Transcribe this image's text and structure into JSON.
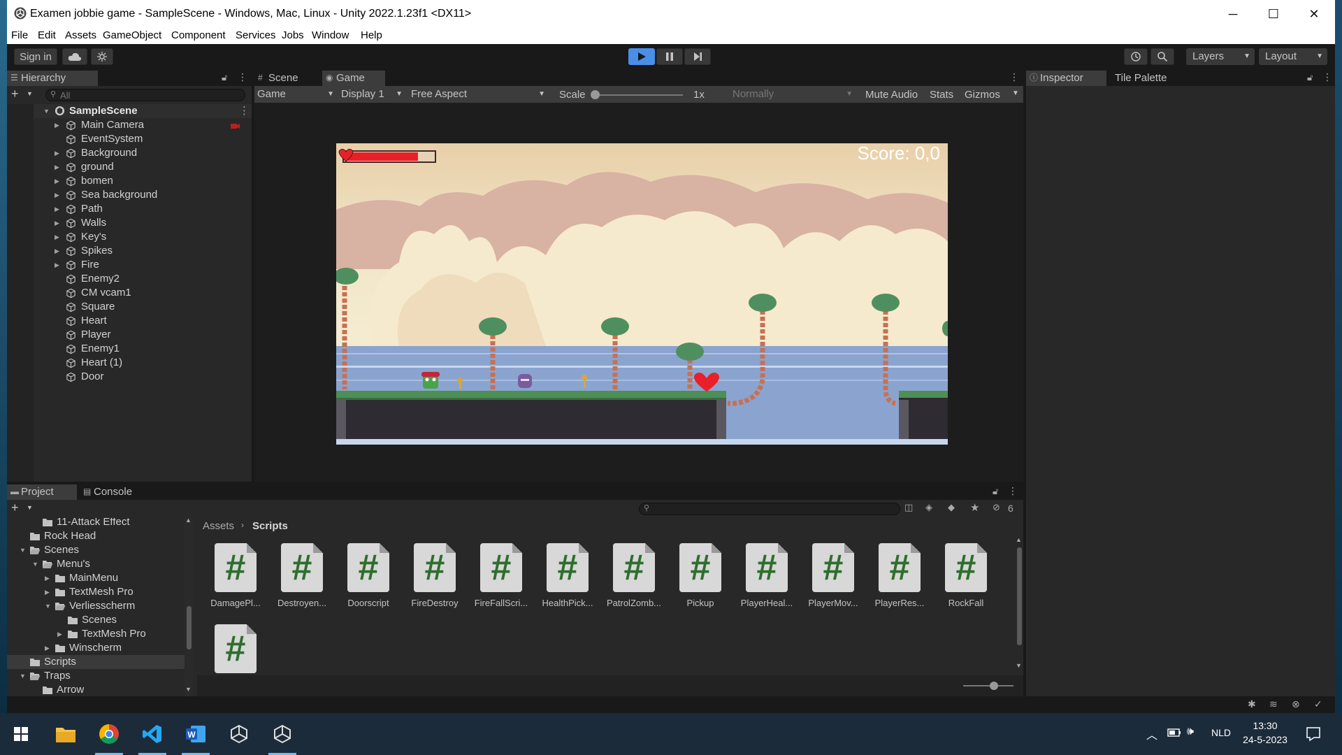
{
  "window": {
    "title": "Examen jobbie game - SampleScene - Windows, Mac, Linux - Unity 2022.1.23f1 <DX11>",
    "minimize": "─",
    "maximize": "☐",
    "close": "✕"
  },
  "menu": [
    "File",
    "Edit",
    "Assets",
    "GameObject",
    "Component",
    "Services",
    "Jobs",
    "Window",
    "Help"
  ],
  "toolbar": {
    "sign_in": "Sign in",
    "layers": "Layers",
    "layout": "Layout"
  },
  "hierarchy": {
    "tab": "Hierarchy",
    "search_placeholder": "All",
    "scene": "SampleScene",
    "items": [
      {
        "name": "Main Camera",
        "expandable": true
      },
      {
        "name": "EventSystem",
        "expandable": false
      },
      {
        "name": "Background",
        "expandable": true
      },
      {
        "name": "ground",
        "expandable": true
      },
      {
        "name": "bomen",
        "expandable": true
      },
      {
        "name": "Sea background",
        "expandable": true
      },
      {
        "name": "Path",
        "expandable": true
      },
      {
        "name": "Walls",
        "expandable": true
      },
      {
        "name": "Key's",
        "expandable": true
      },
      {
        "name": "Spikes",
        "expandable": true
      },
      {
        "name": "Fire",
        "expandable": true
      },
      {
        "name": "Enemy2",
        "expandable": false
      },
      {
        "name": "CM vcam1",
        "expandable": false
      },
      {
        "name": "Square",
        "expandable": false
      },
      {
        "name": "Heart",
        "expandable": false
      },
      {
        "name": "Player",
        "expandable": false
      },
      {
        "name": "Enemy1",
        "expandable": false
      },
      {
        "name": "Heart (1)",
        "expandable": false
      },
      {
        "name": "Door",
        "expandable": false
      }
    ]
  },
  "game_view": {
    "tab_scene": "Scene",
    "tab_game": "Game",
    "mode": "Game",
    "display": "Display 1",
    "aspect": "Free Aspect",
    "scale_label": "Scale",
    "scale_value": "1x",
    "play_focus": "Normally",
    "mute": "Mute Audio",
    "stats": "Stats",
    "gizmos": "Gizmos",
    "score_text": "Score: 0,0",
    "health_fraction": 0.82
  },
  "inspector": {
    "tab_inspector": "Inspector",
    "tab_tile_palette": "Tile Palette"
  },
  "project": {
    "tab_project": "Project",
    "tab_console": "Console",
    "hidden_count": "6",
    "breadcrumb_root": "Assets",
    "breadcrumb_current": "Scripts",
    "tree": [
      {
        "name": "11-Attack Effect",
        "depth": 2,
        "arrow": ""
      },
      {
        "name": "Rock Head",
        "depth": 1,
        "arrow": ""
      },
      {
        "name": "Scenes",
        "depth": 1,
        "arrow": "open"
      },
      {
        "name": "Menu's",
        "depth": 2,
        "arrow": "open"
      },
      {
        "name": "MainMenu",
        "depth": 3,
        "arrow": "closed"
      },
      {
        "name": "TextMesh Pro",
        "depth": 3,
        "arrow": "closed"
      },
      {
        "name": "Verliesscherm",
        "depth": 3,
        "arrow": "open"
      },
      {
        "name": "Scenes",
        "depth": 4,
        "arrow": ""
      },
      {
        "name": "TextMesh Pro",
        "depth": 4,
        "arrow": "closed"
      },
      {
        "name": "Winscherm",
        "depth": 3,
        "arrow": "closed"
      },
      {
        "name": "Scripts",
        "depth": 1,
        "arrow": "",
        "selected": true
      },
      {
        "name": "Traps",
        "depth": 1,
        "arrow": "open"
      },
      {
        "name": "Arrow",
        "depth": 2,
        "arrow": ""
      }
    ],
    "files": [
      "DamagePl...",
      "Destroyen...",
      "Doorscript",
      "FireDestroy",
      "FireFallScri...",
      "HealthPick...",
      "PatrolZomb...",
      "Pickup",
      "PlayerHeal...",
      "PlayerMov...",
      "PlayerRes...",
      "RockFall",
      ""
    ],
    "file_glyph": "#"
  },
  "taskbar": {
    "language": "NLD",
    "time": "13:30",
    "date": "24-5-2023"
  },
  "colors": {
    "accent_blue": "#4a8fe7",
    "sky": "#f2e6c8",
    "sea": "#8aa4cf",
    "health_red": "#e8202a"
  }
}
